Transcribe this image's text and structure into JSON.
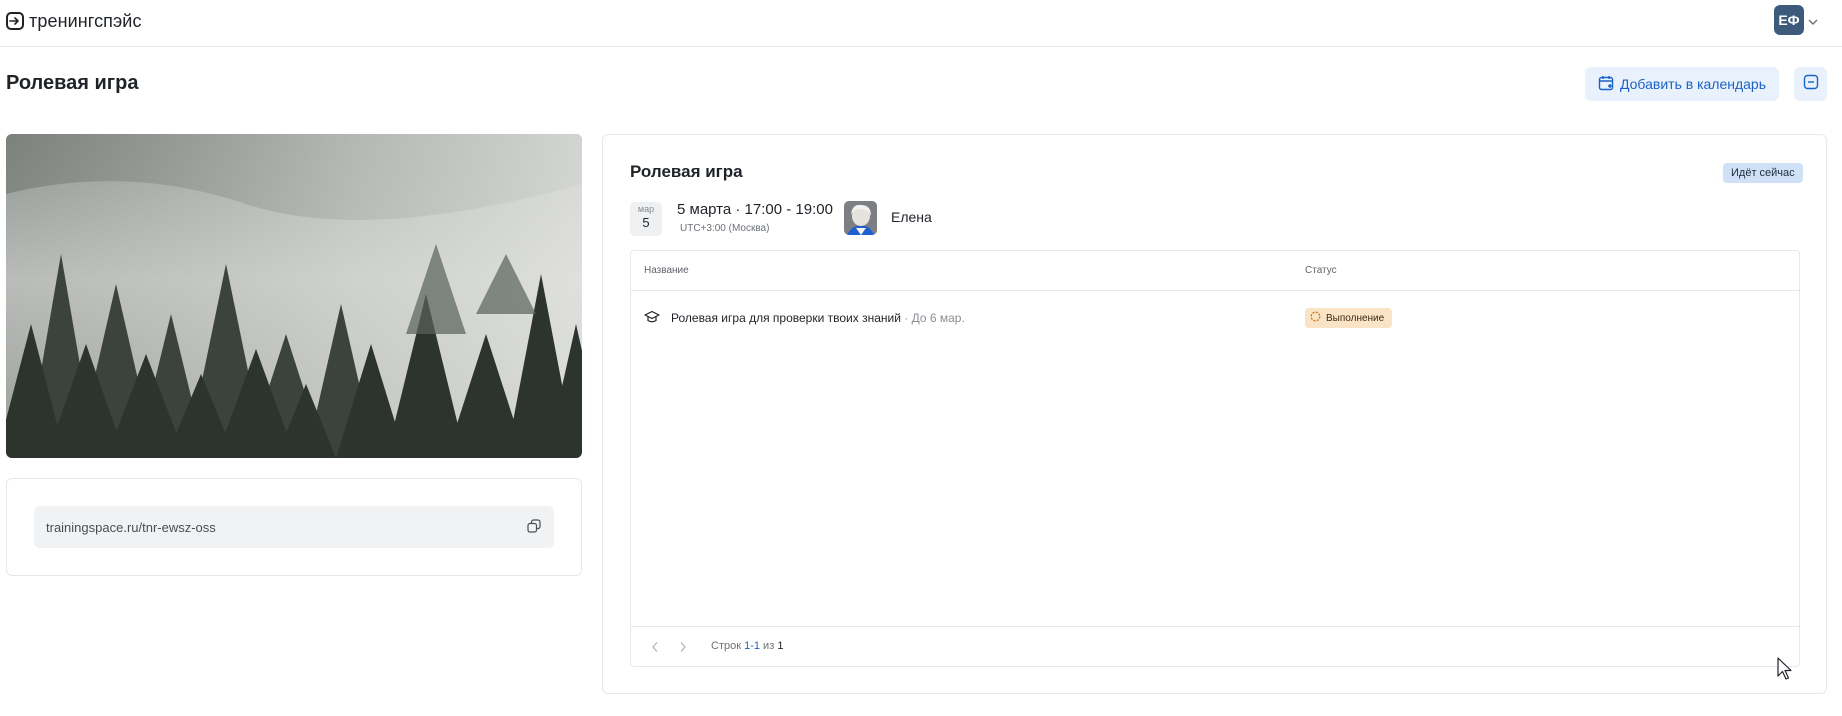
{
  "header": {
    "logo_text": "тренингспэйс",
    "user_initials": "ЕФ"
  },
  "page": {
    "title": "Ролевая игра",
    "add_to_calendar_label": "Добавить в календарь"
  },
  "share": {
    "link": "trainingspace.ru/tnr-ewsz-oss"
  },
  "event": {
    "title": "Ролевая игра",
    "status": "Идёт сейчас",
    "date_month": "мар",
    "date_day": "5",
    "date_time": "5 марта · 17:00 - 19:00",
    "timezone": "UTC+3:00 (Москва)",
    "host_name": "Елена"
  },
  "table": {
    "columns": [
      "Название",
      "Статус"
    ],
    "rows": [
      {
        "title": "Ролевая игра для проверки твоих знаний",
        "due": " · До 6 мар.",
        "status": "Выполнение"
      }
    ],
    "pagination": {
      "prefix": "Строк ",
      "range": "1-1",
      "of": " из ",
      "total": "1"
    }
  },
  "colors": {
    "accent": "#1b63c6",
    "status_live_bg": "#cfe0f7",
    "status_progress_bg": "#fbe3c5",
    "avatar_bg": "#3c5b7a"
  },
  "icons": {
    "logo": "enter-arrow-icon",
    "calendar": "calendar-plus-icon",
    "collapse": "minus-square-icon",
    "copy": "copy-icon",
    "task": "graduation-cap-icon",
    "status": "progress-circle-icon",
    "prev": "chevron-left-icon",
    "next": "chevron-right-icon"
  }
}
